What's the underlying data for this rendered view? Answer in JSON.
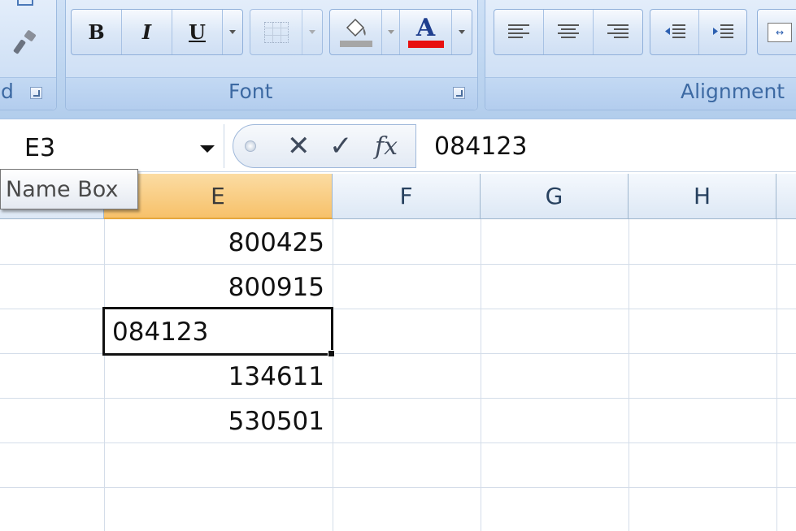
{
  "ribbon": {
    "groups": {
      "clipboard": {
        "label": "d"
      },
      "font": {
        "label": "Font",
        "bold_label": "B",
        "italic_label": "I",
        "underline_label": "U",
        "font_color_label": "A",
        "font_color": "#e81010",
        "fill_color": "#a6a6a6"
      },
      "alignment": {
        "label": "Alignment"
      }
    }
  },
  "formula_bar": {
    "name_box_value": "E3",
    "fx_label": "fx",
    "cancel_glyph": "✕",
    "enter_glyph": "✓",
    "formula_value": "084123"
  },
  "tooltip": {
    "text": "Name Box"
  },
  "grid": {
    "columns": [
      {
        "label": "E",
        "active": true
      },
      {
        "label": "F",
        "active": false
      },
      {
        "label": "G",
        "active": false
      },
      {
        "label": "H",
        "active": false
      }
    ],
    "column_e_values": [
      "800425",
      "800915",
      "084123",
      "134611",
      "530501",
      "",
      ""
    ],
    "selected_cell": "E3"
  },
  "colors": {
    "ribbon_bg": "#bdd5f0",
    "group_label": "#3d6aa3",
    "active_header": "#f7c16a",
    "grid_line": "#d4dde9"
  }
}
